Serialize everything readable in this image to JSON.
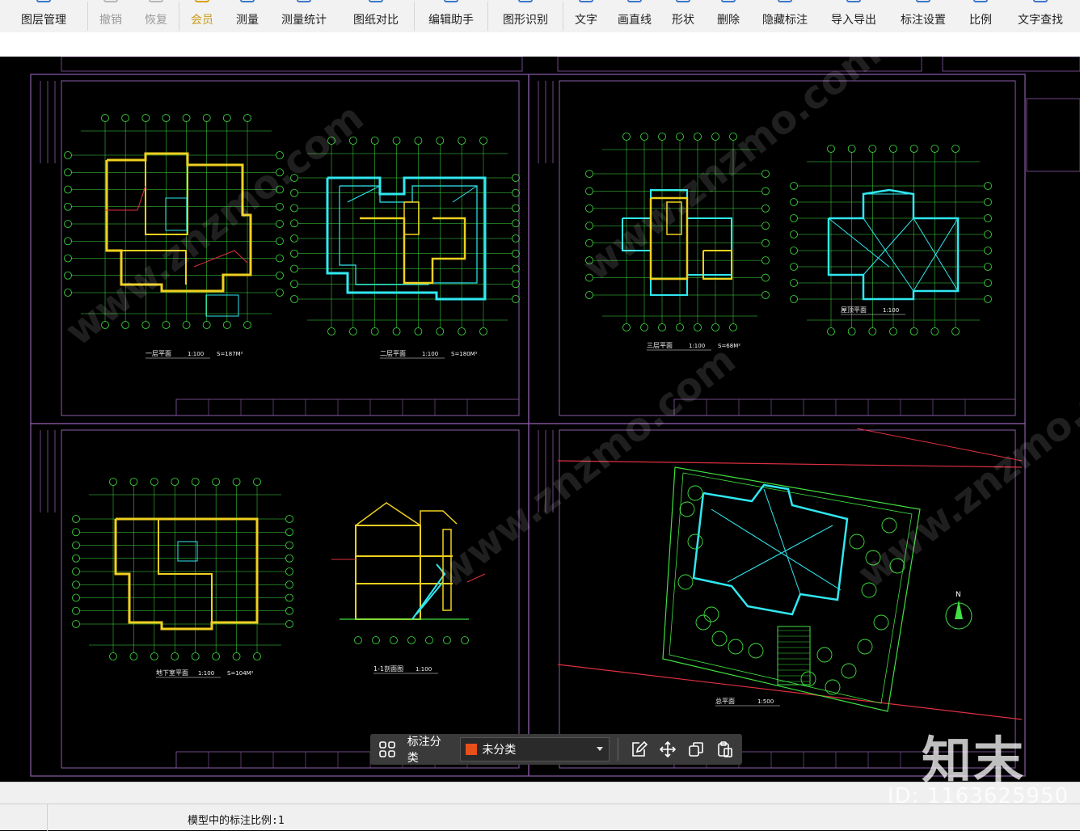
{
  "toolbar": {
    "items": [
      {
        "label": "图层管理",
        "icon": "layers-icon",
        "state": "normal"
      },
      {
        "label": "撤销",
        "icon": "undo-icon",
        "state": "disabled"
      },
      {
        "label": "恢复",
        "icon": "redo-icon",
        "state": "disabled"
      },
      {
        "label": "会员",
        "icon": "vip-icon",
        "state": "highlight"
      },
      {
        "label": "测量",
        "icon": "ruler-icon",
        "state": "normal"
      },
      {
        "label": "测量统计",
        "icon": "measure-stats-icon",
        "state": "normal"
      },
      {
        "label": "图纸对比",
        "icon": "compare-icon",
        "state": "normal"
      },
      {
        "label": "编辑助手",
        "icon": "edit-assistant-icon",
        "state": "normal"
      },
      {
        "label": "图形识别",
        "icon": "shape-recognize-icon",
        "state": "normal"
      },
      {
        "label": "文字",
        "icon": "text-icon",
        "state": "normal"
      },
      {
        "label": "画直线",
        "icon": "line-icon",
        "state": "normal"
      },
      {
        "label": "形状",
        "icon": "shape-icon",
        "state": "normal"
      },
      {
        "label": "删除",
        "icon": "delete-icon",
        "state": "normal"
      },
      {
        "label": "隐藏标注",
        "icon": "hide-annotation-icon",
        "state": "normal"
      },
      {
        "label": "导入导出",
        "icon": "import-export-icon",
        "state": "normal"
      },
      {
        "label": "标注设置",
        "icon": "annotation-settings-icon",
        "state": "normal"
      },
      {
        "label": "比例",
        "icon": "scale-icon",
        "state": "normal"
      },
      {
        "label": "文字查找",
        "icon": "text-search-icon",
        "state": "normal"
      }
    ]
  },
  "drawing": {
    "sheets": [
      {
        "title": "一层平面",
        "scale": "1:100",
        "area": "S=187M²"
      },
      {
        "title": "二层平面",
        "scale": "1:100",
        "area": "S=180M²"
      },
      {
        "title": "三层平面",
        "scale": "1:100",
        "area": "S=68M²"
      },
      {
        "title": "屋顶平面",
        "scale": "1:100",
        "area": ""
      },
      {
        "title": "地下室平面",
        "scale": "1:100",
        "area": "S=104M²"
      },
      {
        "title": "1-1剖面图",
        "scale": "1:100",
        "area": ""
      },
      {
        "title": "总平面",
        "scale": "1:500",
        "area": ""
      }
    ],
    "north_label": "N",
    "watermark_text": "www.znzmo.com"
  },
  "annotation_bar": {
    "label": "标注分类",
    "category": "未分类",
    "category_color": "#e8501a"
  },
  "status": {
    "text": "模型中的标注比例:1"
  },
  "watermark": {
    "logo": "知末",
    "id": "ID: 1163625950"
  },
  "colors": {
    "toolbar_bg": "#f2f2f2",
    "canvas_bg": "#000000",
    "frame": "#8a5ca8",
    "wall_yellow": "#f0d020",
    "wall_cyan": "#30e8f0",
    "grid_green": "#40e040",
    "dim_red": "#e03040"
  }
}
